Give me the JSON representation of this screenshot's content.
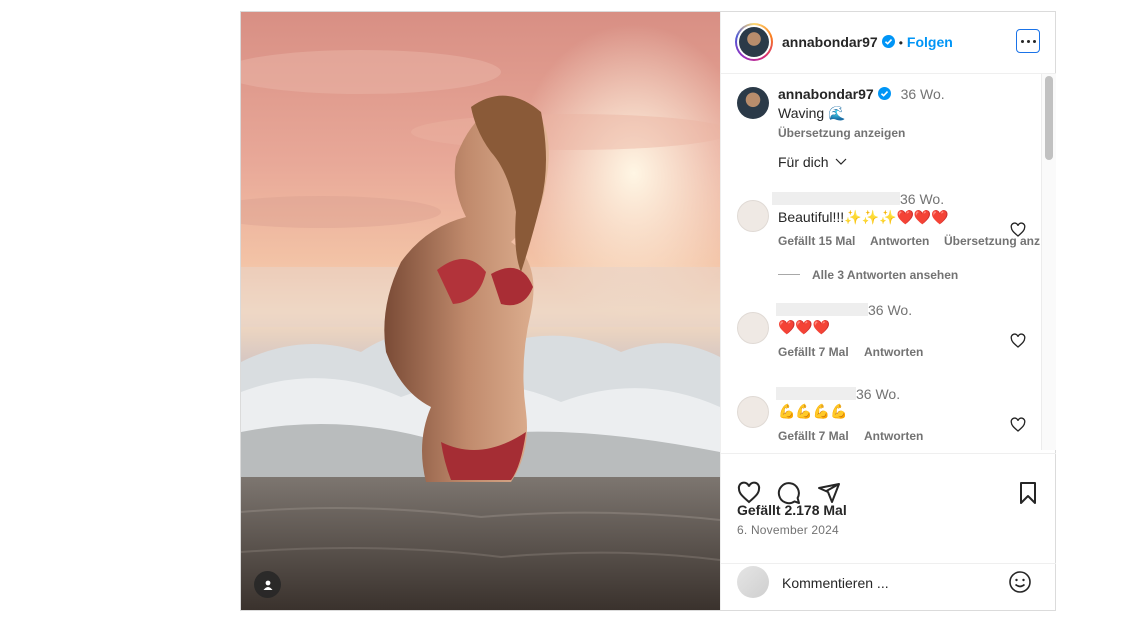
{
  "post": {
    "username": "annabondar97",
    "follow_label": "Folgen",
    "separator": "•"
  },
  "caption": {
    "username": "annabondar97",
    "time": "36 Wo.",
    "text": "Waving 🌊",
    "translation_label": "Übersetzung anzeigen"
  },
  "filter": {
    "label": "Für dich"
  },
  "comments": [
    {
      "time": "36 Wo.",
      "text": "Beautiful!!!✨✨✨❤️❤️❤️",
      "likes_label": "Gefällt 15 Mal",
      "reply_label": "Antworten",
      "translation_label": "Übersetzung anz",
      "replies_label": "Alle 3 Antworten ansehen"
    },
    {
      "time": "36 Wo.",
      "text": "❤️❤️❤️",
      "likes_label": "Gefällt 7 Mal",
      "reply_label": "Antworten"
    },
    {
      "time": "36 Wo.",
      "text": "💪💪💪💪",
      "likes_label": "Gefällt 7 Mal",
      "reply_label": "Antworten"
    }
  ],
  "stats": {
    "likes": "Gefällt 2.178 Mal",
    "date": "6. November 2024"
  },
  "comment_box": {
    "placeholder": "Kommentieren ..."
  },
  "colors": {
    "follow": "#0095f6",
    "verified": "#0095f6",
    "heart": "#e0245e",
    "muted": "#737373"
  },
  "icons": [
    "tag-user-icon",
    "verified-icon",
    "more-options-icon",
    "like-icon",
    "comment-icon",
    "share-icon",
    "save-icon",
    "emoji-icon",
    "chevron-down-icon"
  ]
}
